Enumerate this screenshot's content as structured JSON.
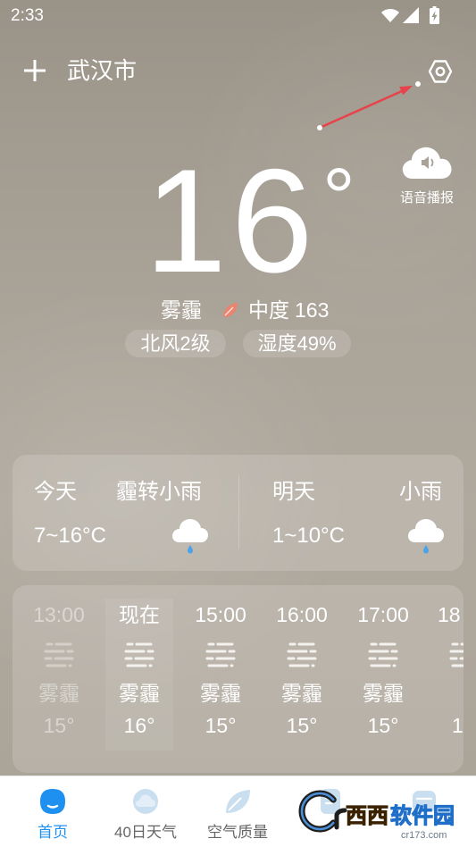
{
  "status_bar": {
    "time": "2:33",
    "icons": [
      "wifi-icon",
      "signal-icon",
      "battery-charging-icon"
    ]
  },
  "header": {
    "city": "武汉市",
    "add_icon": "plus-icon",
    "settings_icon": "settings-hexagon-icon"
  },
  "voice": {
    "label": "语音播报",
    "icon": "speaker-cloud-icon"
  },
  "current": {
    "temperature": "16",
    "degree_symbol": "°",
    "condition": "雾霾",
    "aqi_icon": "leaf-icon",
    "aqi_level": "中度",
    "aqi_value": "163",
    "wind": "北风2级",
    "humidity": "湿度49%"
  },
  "daily": [
    {
      "day": "今天",
      "condition": "霾转小雨",
      "range": "7~16°C",
      "icon": "rain-cloud-icon"
    },
    {
      "day": "明天",
      "condition": "小雨",
      "range": "1~10°C",
      "icon": "rain-cloud-icon"
    }
  ],
  "hourly": [
    {
      "time": "13:00",
      "condition": "雾霾",
      "temp": "15°",
      "icon": "haze-icon",
      "past": true
    },
    {
      "time": "现在",
      "condition": "雾霾",
      "temp": "16°",
      "icon": "haze-icon",
      "current": true
    },
    {
      "time": "15:00",
      "condition": "雾霾",
      "temp": "15°",
      "icon": "haze-icon"
    },
    {
      "time": "16:00",
      "condition": "雾霾",
      "temp": "15°",
      "icon": "haze-icon"
    },
    {
      "time": "17:00",
      "condition": "雾霾",
      "temp": "15°",
      "icon": "haze-icon"
    },
    {
      "time": "18",
      "temp": "1",
      "icon": "haze-icon"
    }
  ],
  "nav": {
    "items": [
      {
        "label": "首页",
        "icon": "home-icon",
        "active": true
      },
      {
        "label": "40日天气",
        "icon": "cloud-icon"
      },
      {
        "label": "空气质量",
        "icon": "leaf-icon"
      },
      {
        "icon": "document-icon"
      },
      {
        "icon": "box-icon"
      }
    ]
  },
  "watermark": {
    "brand_part1": "西西",
    "brand_part2": "软件园",
    "site": "cr173.com"
  },
  "colors": {
    "accent": "#1e90f0",
    "aqi_moderate": "#e9846f",
    "rain_drop": "#4da3e8",
    "annotation_arrow": "#e8424a",
    "nav_inactive_icon": "#c9dff0"
  }
}
